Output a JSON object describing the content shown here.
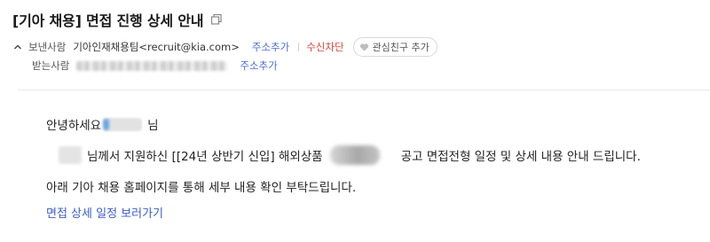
{
  "email": {
    "subject": "[기아 채용] 면접 진행 상세 안내",
    "sender": {
      "label": "보낸사람",
      "name": "기아인재채용팀<recruit@kia.com>",
      "add_address": "주소추가",
      "block": "수신차단",
      "add_friend": "관심친구 추가"
    },
    "recipient": {
      "label": "받는사람",
      "add_address": "주소추가"
    },
    "body": {
      "greeting_prefix": "안녕하세요",
      "greeting_suffix": "님",
      "line2_a": "님께서 지원하신 [[24년 상반기 신입] 해외상품",
      "line2_b": "공고 면접전형 일정 및 상세 내용 안내 드립니다.",
      "line3": "아래 기아 채용 홈페이지를 통해 세부 내용 확인 부탁드립니다.",
      "link_text": "면접 상세 일정 보러가기"
    }
  },
  "colors": {
    "link": "#4a6cd4",
    "block": "#e0433a",
    "text": "#222222"
  },
  "icons": [
    "copy-icon",
    "chevron-up-icon",
    "heart-icon"
  ]
}
